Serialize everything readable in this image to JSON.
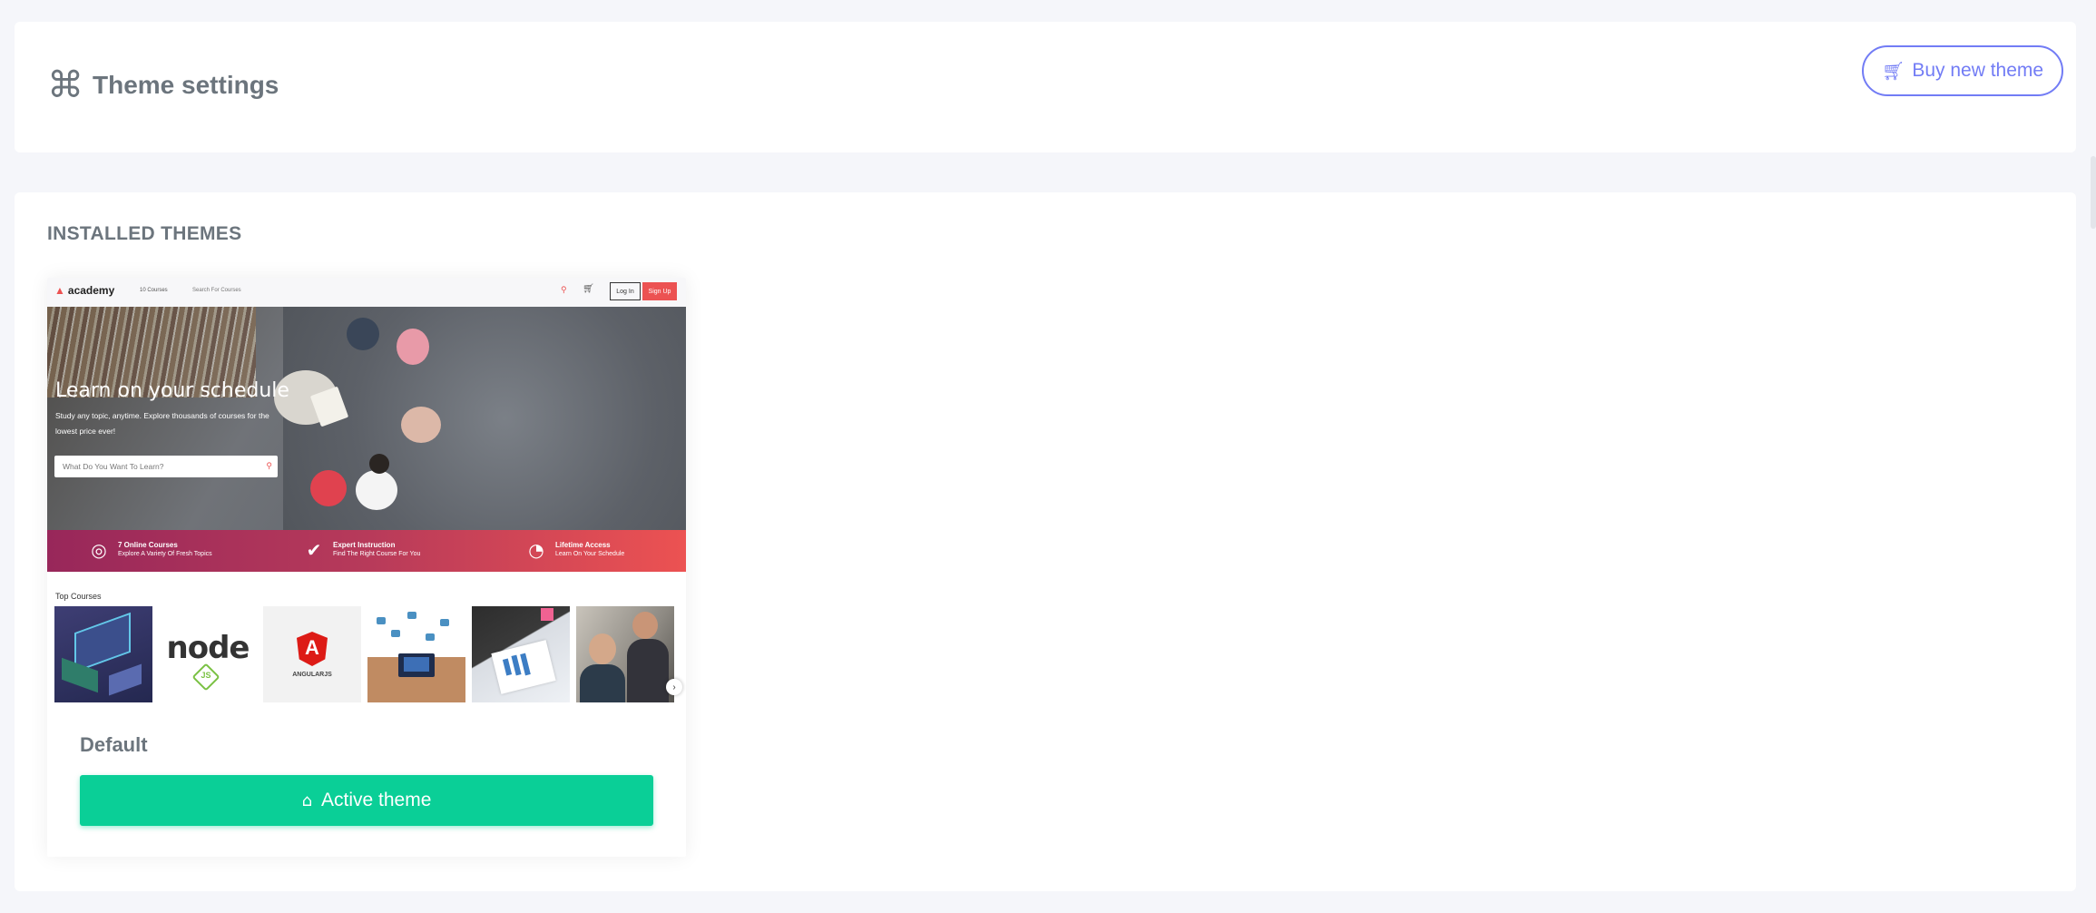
{
  "header": {
    "title": "Theme settings",
    "title_icon": "command-icon",
    "buy_button_label": "Buy new theme",
    "buy_button_icon": "cart-icon"
  },
  "installed": {
    "section_title": "INSTALLED THEMES",
    "themes": [
      {
        "name": "Default",
        "status_button_label": "Active theme",
        "status_button_icon": "home-icon",
        "preview": {
          "logo": "academy",
          "nav_courses": "10 Courses",
          "nav_search_placeholder": "Search For Courses",
          "login_label": "Log In",
          "signup_label": "Sign Up",
          "hero_title": "Learn on your schedule",
          "hero_text": "Study any topic, anytime. Explore thousands of courses for the lowest price ever!",
          "hero_search_placeholder": "What Do You Want To Learn?",
          "features": [
            {
              "icon": "target-icon",
              "title": "7 Online Courses",
              "subtitle": "Explore A Variety Of Fresh Topics"
            },
            {
              "icon": "check-icon",
              "title": "Expert Instruction",
              "subtitle": "Find The Right Course For You"
            },
            {
              "icon": "clock-icon",
              "title": "Lifetime Access",
              "subtitle": "Learn On Your Schedule"
            }
          ],
          "top_courses_label": "Top Courses",
          "course_tiles": [
            "web-dev-thumbnail",
            "node-js-thumbnail",
            "angularjs-thumbnail",
            "programming-thumbnail",
            "analytics-thumbnail",
            "team-thumbnail"
          ],
          "tile_texts": {
            "node": "node",
            "js": "JS",
            "angular": "ANGULARJS"
          }
        }
      }
    ]
  },
  "colors": {
    "accent": "#727cf5",
    "success": "#0acf97",
    "brand_red": "#ec5252",
    "text": "#6c757d"
  }
}
